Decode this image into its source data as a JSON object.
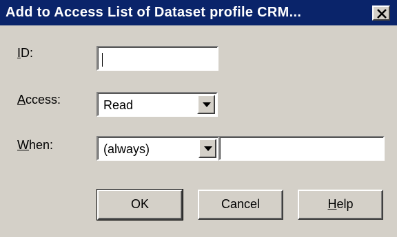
{
  "window": {
    "title": "Add to Access List of Dataset profile CRM..."
  },
  "form": {
    "id_label_mnemonic": "I",
    "id_label_rest": "D:",
    "id_value": "",
    "access_label_mnemonic": "A",
    "access_label_rest": "ccess:",
    "access_selected": "Read",
    "when_label_mnemonic": "W",
    "when_label_rest": "hen:",
    "when_selected": "(always)",
    "when_value": ""
  },
  "buttons": {
    "ok_label": "OK",
    "cancel_label": "Cancel",
    "help_mnemonic": "H",
    "help_rest": "elp"
  },
  "icons": {
    "close": "close-icon",
    "dropdown": "chevron-down-icon"
  },
  "colors": {
    "titlebar": "#0a246a",
    "face": "#d4d0c8"
  }
}
